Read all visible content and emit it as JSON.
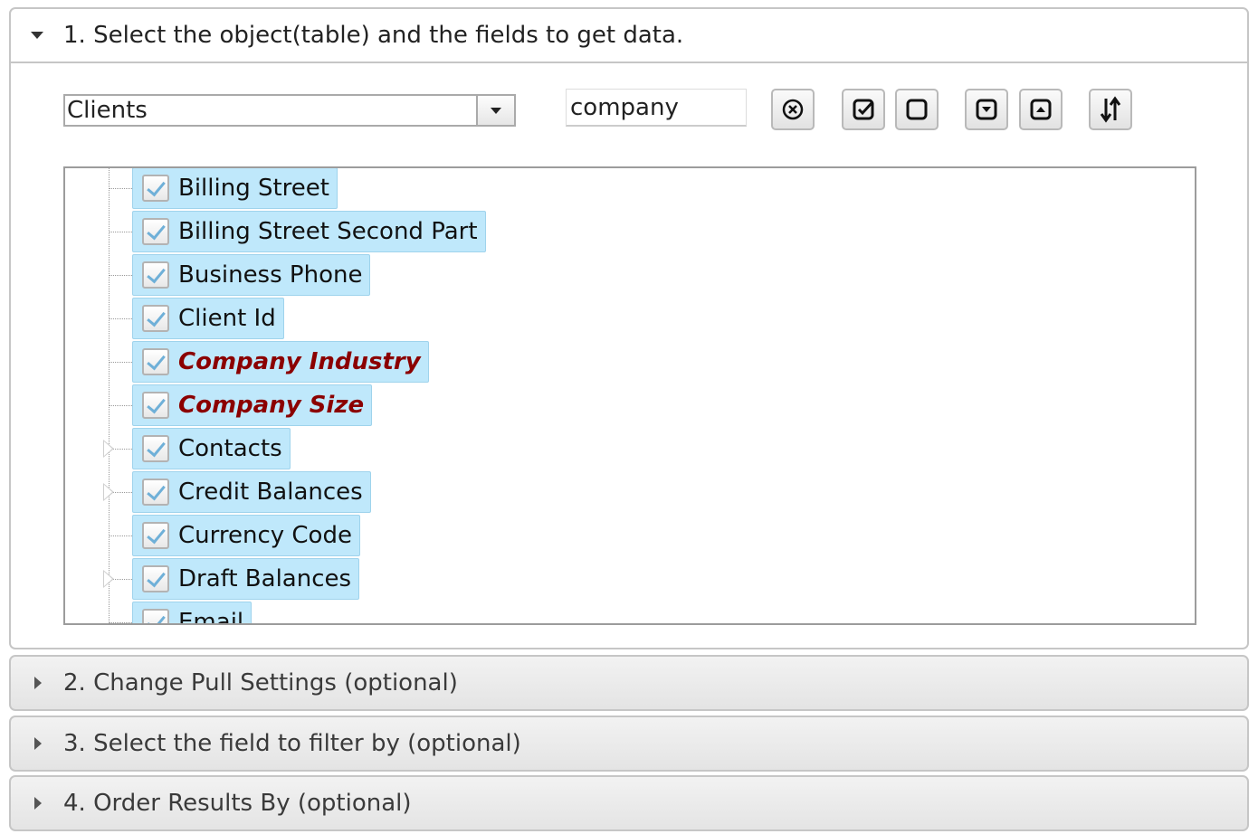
{
  "sections": [
    {
      "title": "1. Select the object(table) and the fields to get data.",
      "state": "expanded"
    },
    {
      "title": "2. Change Pull Settings (optional)",
      "state": "collapsed"
    },
    {
      "title": "3. Select the field to filter by (optional)",
      "state": "collapsed"
    },
    {
      "title": "4. Order Results By (optional)",
      "state": "collapsed"
    }
  ],
  "toolbar": {
    "object_select_value": "Clients",
    "search_value": "company",
    "buttons": [
      {
        "name": "clear-search-button",
        "icon": "circle-x-icon"
      },
      {
        "name": "check-all-button",
        "icon": "checkbox-checked-icon"
      },
      {
        "name": "uncheck-all-button",
        "icon": "checkbox-empty-icon"
      },
      {
        "name": "expand-all-button",
        "icon": "square-chevron-down-icon"
      },
      {
        "name": "collapse-all-button",
        "icon": "square-chevron-up-icon"
      },
      {
        "name": "sort-button",
        "icon": "sort-arrows-icon"
      }
    ]
  },
  "tree": {
    "items": [
      {
        "label": "Billing Street",
        "checked": true,
        "highlighted": false,
        "expandable": false
      },
      {
        "label": "Billing Street Second Part",
        "checked": true,
        "highlighted": false,
        "expandable": false
      },
      {
        "label": "Business Phone",
        "checked": true,
        "highlighted": false,
        "expandable": false
      },
      {
        "label": "Client Id",
        "checked": true,
        "highlighted": false,
        "expandable": false
      },
      {
        "label": "Company Industry",
        "checked": true,
        "highlighted": true,
        "expandable": false
      },
      {
        "label": "Company Size",
        "checked": true,
        "highlighted": true,
        "expandable": false
      },
      {
        "label": "Contacts",
        "checked": true,
        "highlighted": false,
        "expandable": true
      },
      {
        "label": "Credit Balances",
        "checked": true,
        "highlighted": false,
        "expandable": true
      },
      {
        "label": "Currency Code",
        "checked": true,
        "highlighted": false,
        "expandable": false
      },
      {
        "label": "Draft Balances",
        "checked": true,
        "highlighted": false,
        "expandable": true
      },
      {
        "label": "Email",
        "checked": true,
        "highlighted": false,
        "expandable": false
      }
    ]
  },
  "colors": {
    "chip_background": "#bfe8fb",
    "highlight_text": "#8b0000"
  }
}
